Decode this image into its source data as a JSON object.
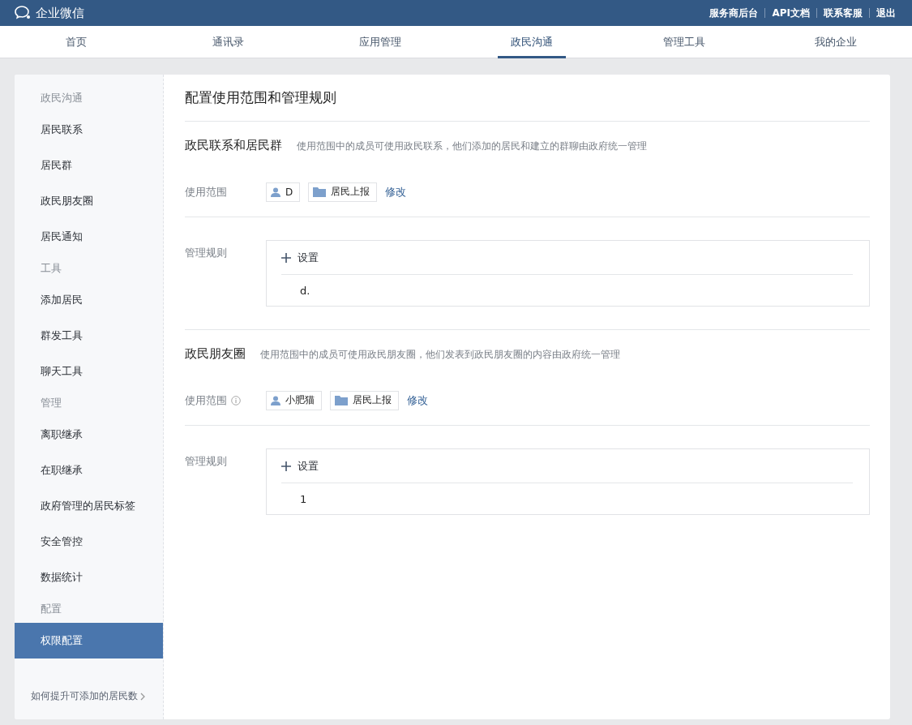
{
  "header": {
    "logo_text": "企业微信",
    "links": [
      "服务商后台",
      "API文档",
      "联系客服",
      "退出"
    ]
  },
  "nav": [
    {
      "label": "首页",
      "selected": false
    },
    {
      "label": "通讯录",
      "selected": false
    },
    {
      "label": "应用管理",
      "selected": false
    },
    {
      "label": "政民沟通",
      "selected": true
    },
    {
      "label": "管理工具",
      "selected": false
    },
    {
      "label": "我的企业",
      "selected": false
    }
  ],
  "sidebar": {
    "groups": [
      {
        "heading": "政民沟通",
        "items": [
          {
            "label": "居民联系",
            "selected": false
          },
          {
            "label": "居民群",
            "selected": false
          },
          {
            "label": "政民朋友圈",
            "selected": false
          },
          {
            "label": "居民通知",
            "selected": false
          }
        ]
      },
      {
        "heading": "工具",
        "items": [
          {
            "label": "添加居民",
            "selected": false
          },
          {
            "label": "群发工具",
            "selected": false
          },
          {
            "label": "聊天工具",
            "selected": false
          }
        ]
      },
      {
        "heading": "管理",
        "items": [
          {
            "label": "离职继承",
            "selected": false
          },
          {
            "label": "在职继承",
            "selected": false
          },
          {
            "label": "政府管理的居民标签",
            "selected": false
          },
          {
            "label": "安全管控",
            "selected": false
          },
          {
            "label": "数据统计",
            "selected": false
          }
        ]
      },
      {
        "heading": "配置",
        "items": [
          {
            "label": "权限配置",
            "selected": true
          }
        ]
      }
    ],
    "footer_link": "如何提升可添加的居民数"
  },
  "page_title": "配置使用范围和管理规则",
  "sections": [
    {
      "title": "政民联系和居民群",
      "description": "使用范围中的成员可使用政民联系，他们添加的居民和建立的群聊由政府统一管理",
      "scope_label": "使用范围",
      "info": false,
      "scope": [
        {
          "kind": "user",
          "label": "D"
        },
        {
          "kind": "department",
          "label": "居民上报"
        }
      ],
      "modify": "修改",
      "rules_label": "管理规则",
      "add_label": "设置",
      "rules": [
        "d."
      ]
    },
    {
      "title": "政民朋友圈",
      "description": "使用范围中的成员可使用政民朋友圈，他们发表到政民朋友圈的内容由政府统一管理",
      "scope_label": "使用范围",
      "info": true,
      "scope": [
        {
          "kind": "user",
          "label": "小肥猫"
        },
        {
          "kind": "department",
          "label": "居民上报"
        }
      ],
      "modify": "修改",
      "rules_label": "管理规则",
      "add_label": "设置",
      "rules": [
        "1"
      ]
    }
  ]
}
